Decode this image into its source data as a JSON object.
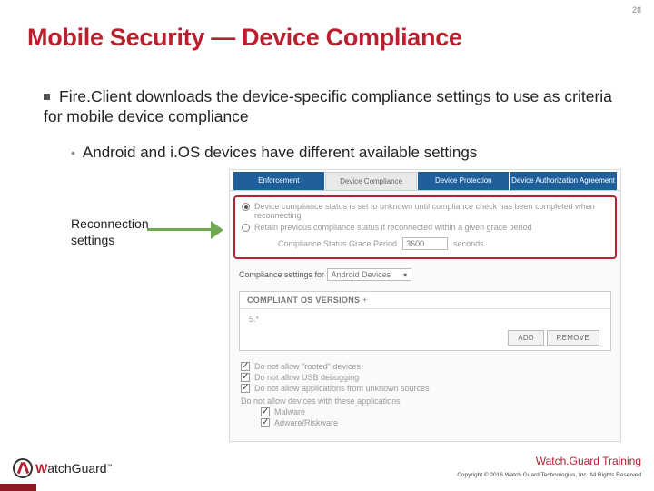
{
  "page_number": "28",
  "title": "Mobile Security — Device Compliance",
  "bullets": {
    "b1": "Fire.Client downloads the device-specific compliance settings to use as criteria for mobile device compliance",
    "b2": "Android and i.OS devices have different available settings"
  },
  "callout": {
    "line1": "Reconnection",
    "line2": "settings"
  },
  "tabs": {
    "enforcement": "Enforcement",
    "compliance": "Device Compliance",
    "protection": "Device Protection",
    "agreement": "Device Authorization Agreement"
  },
  "reconnect": {
    "opt1": "Device compliance status is set to unknown until compliance check has been completed when reconnecting",
    "opt2": "Retain previous compliance status if reconnected within a given grace period",
    "grace_label": "Compliance Status Grace Period",
    "grace_value": "3600",
    "grace_unit": "seconds"
  },
  "settings_for": {
    "label": "Compliance settings for",
    "value": "Android Devices"
  },
  "os_box": {
    "header": "COMPLIANT OS VERSIONS",
    "plus": "+",
    "row": "5.*",
    "add": "ADD",
    "remove": "REMOVE"
  },
  "checks": {
    "c1": "Do not allow \"rooted\" devices",
    "c2": "Do not allow USB debugging",
    "c3": "Do not allow applications from unknown sources",
    "group": "Do not allow devices with these applications",
    "g1": "Malware",
    "g2": "Adware/Riskware"
  },
  "footer": {
    "training": "Watch.Guard Training",
    "copyright": "Copyright © 2016 Watch.Guard Technologies, Inc. All Rights Reserved"
  },
  "logo": {
    "w": "W",
    "rest": "atchGuard",
    "tm": "™"
  }
}
